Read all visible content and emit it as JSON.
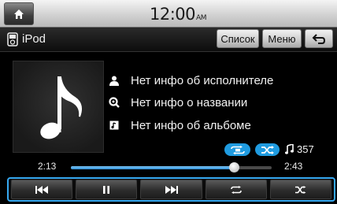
{
  "status_bar": {
    "home_icon": "home-icon",
    "time": "12:00",
    "ampm": "AM"
  },
  "title_bar": {
    "source_icon": "ipod-icon",
    "source_label": "iPod",
    "list_button": "Список",
    "menu_button": "Меню",
    "back_icon": "back-arrow-icon"
  },
  "track_info": {
    "artist": "Нет инфо об исполнителе",
    "title": "Нет инфо о названии",
    "album": "Нет инфо об альбоме",
    "artist_icon": "person-icon",
    "title_icon": "search-title-icon",
    "album_icon": "album-icon",
    "album_art_icon": "music-note-icon"
  },
  "modes": {
    "repeat_icon": "repeat-mode-icon",
    "shuffle_icon": "shuffle-mode-icon",
    "track_count_icon": "music-note-icon",
    "track_count": "357"
  },
  "progress": {
    "elapsed": "2:13",
    "total": "2:43",
    "fraction": 0.81
  },
  "controls": [
    {
      "name": "previous",
      "icon": "skip-previous-icon"
    },
    {
      "name": "pause",
      "icon": "pause-icon"
    },
    {
      "name": "next",
      "icon": "skip-next-icon"
    },
    {
      "name": "repeat",
      "icon": "repeat-icon"
    },
    {
      "name": "shuffle",
      "icon": "shuffle-icon"
    }
  ],
  "colors": {
    "accent": "#1f9be0",
    "control_border": "#36a8f0"
  }
}
